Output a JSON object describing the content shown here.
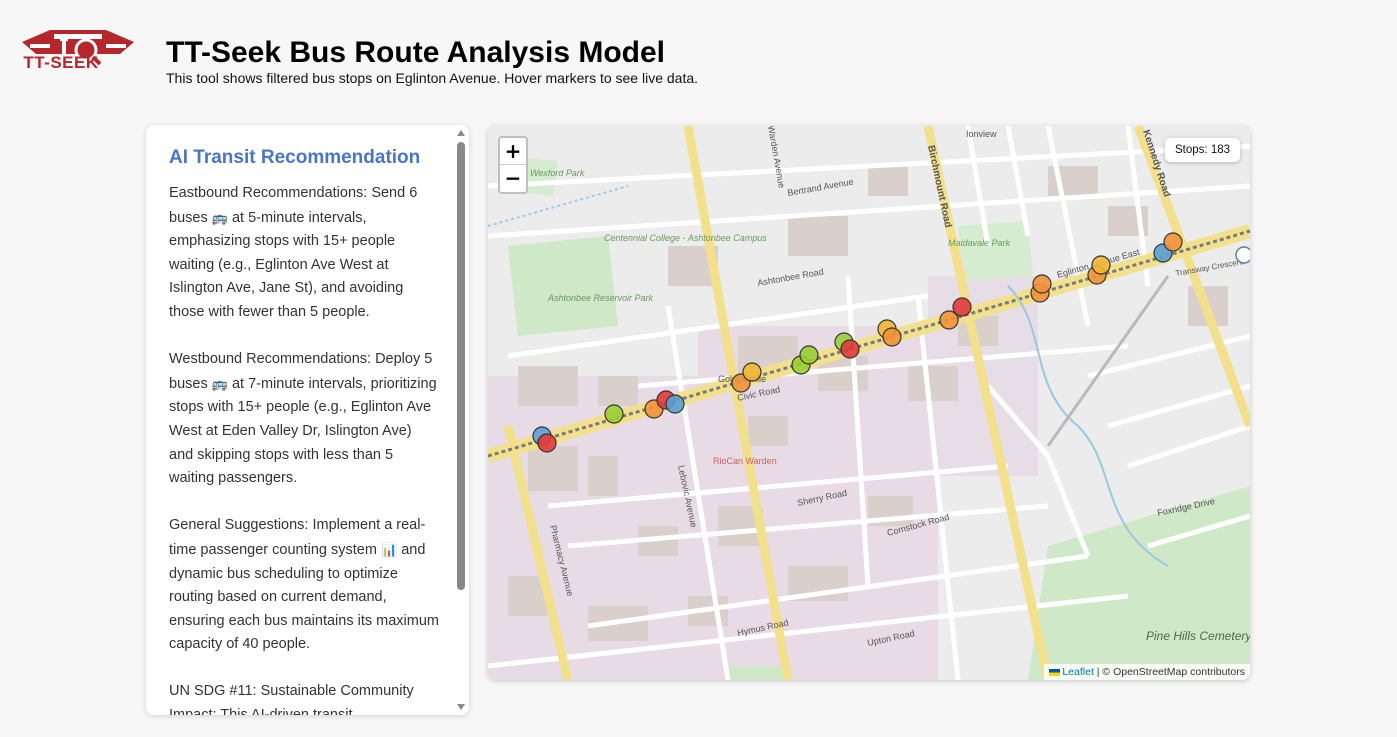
{
  "header": {
    "logo_text": "TT-SEEK",
    "title": "TT-Seek Bus Route Analysis Model",
    "subtitle": "This tool shows filtered bus stops on Eglinton Avenue. Hover markers to see live data."
  },
  "panel": {
    "heading": "AI Transit Recommendation",
    "p1a": "Eastbound Recommendations: Send 6 buses",
    "p1b": "at 5-minute intervals, emphasizing stops with 15+ people waiting (e.g., Eglinton Ave West at Islington Ave, Jane St), and avoiding those with fewer than 5 people.",
    "p2a": "Westbound Recommendations: Deploy 5 buses",
    "p2b": "at 7-minute intervals, prioritizing stops with 15+ people (e.g., Eglinton Ave West at Eden Valley Dr, Islington Ave) and skipping stops with less than 5 waiting passengers.",
    "p3a": "General Suggestions: Implement a real-time passenger counting system",
    "p3b": "and dynamic bus scheduling to optimize routing based on current demand, ensuring each bus maintains its maximum capacity of 40 people.",
    "p4": "UN SDG #11: Sustainable Community Impact: This AI-driven transit",
    "bus_emoji": "🚌",
    "chart_emoji": "📊"
  },
  "map": {
    "zoom_in": "+",
    "zoom_out": "−",
    "stops_label": "Stops: 183",
    "attribution_leaflet": "Leaflet",
    "attribution_rest": " | © OpenStreetMap contributors",
    "labels": {
      "wexford": "Wexford Park",
      "centennial": "Centennial College - Ashtonbee Campus",
      "ashtonbee_res": "Ashtonbee Reservoir Park",
      "maidavale": "Maidavale Park",
      "riocan": "RioCan Warden",
      "pine_hills": "Pine Hills Cemetery",
      "bertrand": "Bertrand Avenue",
      "ashtonbee_rd": "Ashtonbee Road",
      "civic": "Civic Road",
      "sherry": "Sherry Road",
      "comstock": "Comstock Road",
      "foxridge": "Foxridge Drive",
      "birchmount": "Birchmount Road",
      "kennedy": "Kennedy Road",
      "warden": "Warden Avenue",
      "pharmacy": "Pharmacy Avenue",
      "eglinton": "Eglinton Avenue East",
      "hymus": "Hymus Road",
      "transway": "Transway Crescent",
      "lebovic": "Lebovic Avenue",
      "ionview": "Ionview",
      "upton": "Upton Road",
      "golden_mile": "Golden Mile"
    },
    "marker_colors": {
      "green": "#9acd32",
      "orange": "#f0923a",
      "red": "#e03a3a",
      "blue": "#5a9fd4",
      "yellow": "#f2b634"
    }
  }
}
